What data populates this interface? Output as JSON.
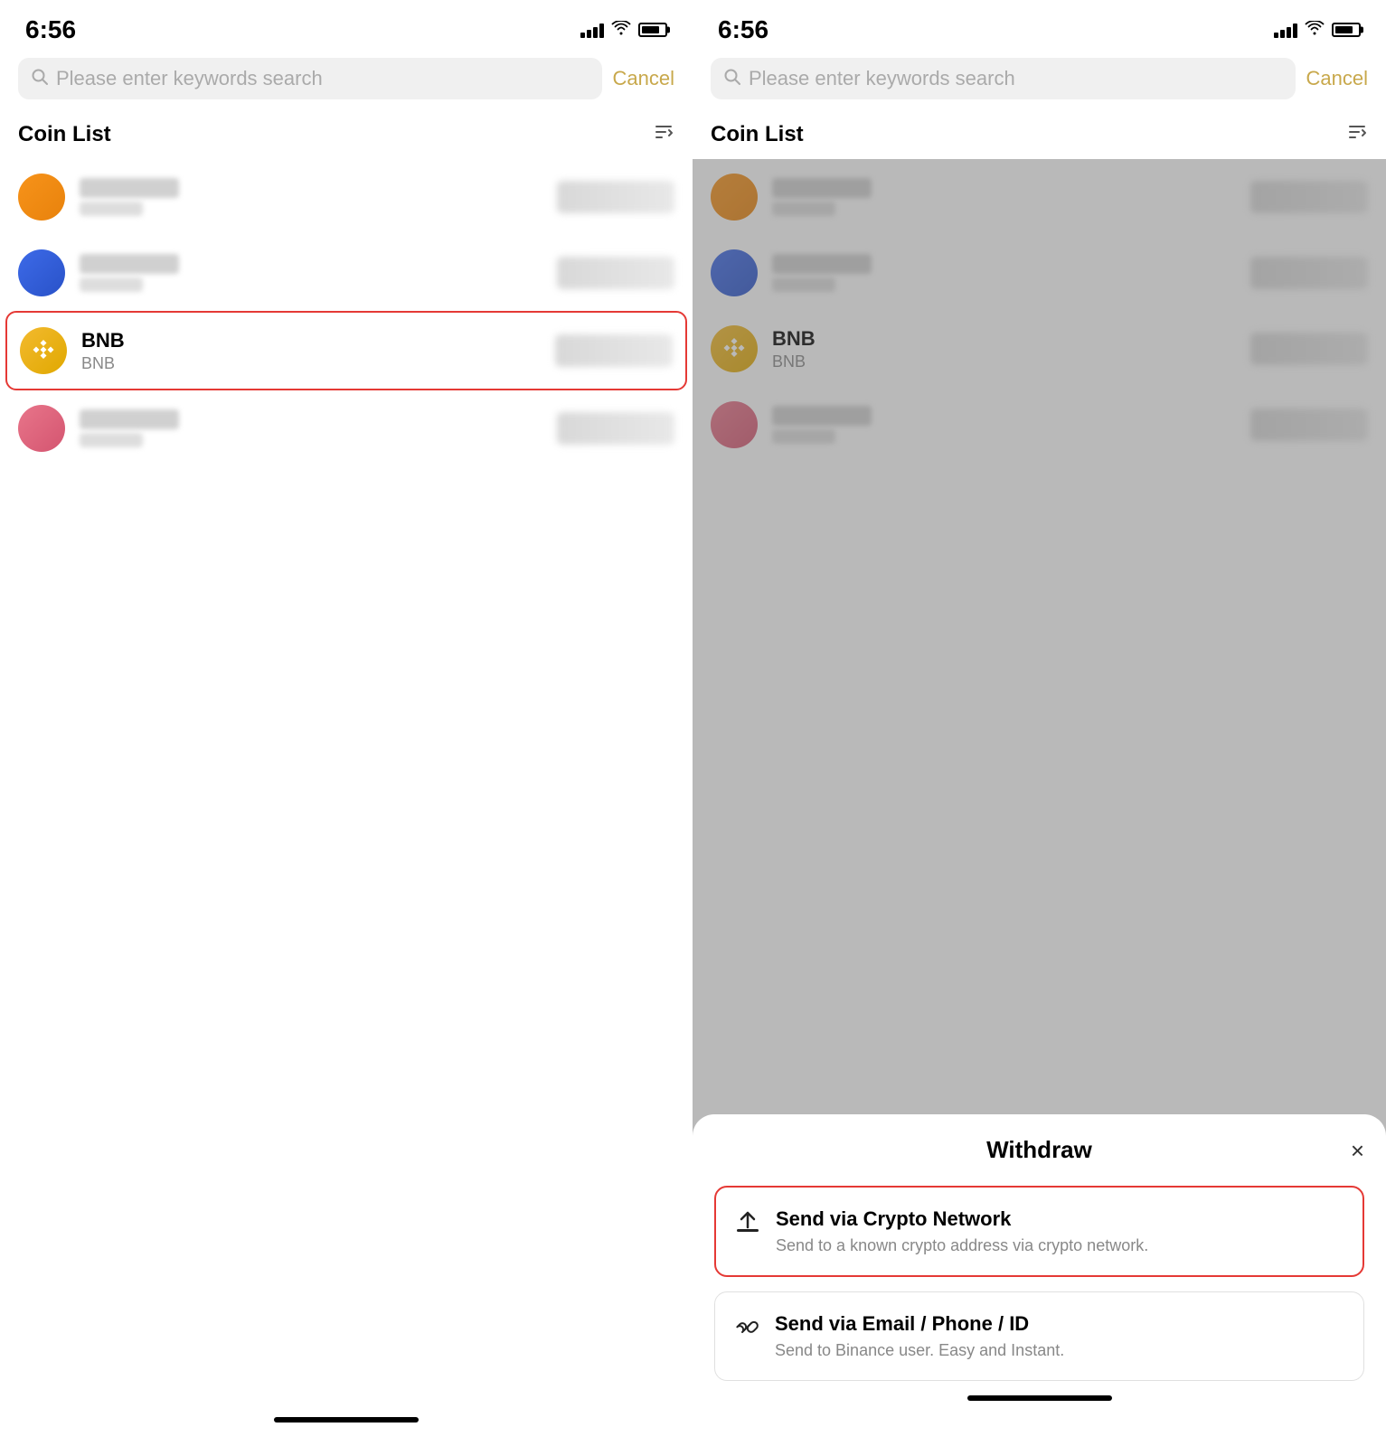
{
  "left_panel": {
    "status_time": "6:56",
    "search_placeholder": "Please enter keywords search",
    "cancel_label": "Cancel",
    "coin_list_title": "Coin List",
    "coins": [
      {
        "id": "coin1",
        "type": "orange",
        "blurred": true
      },
      {
        "id": "coin2",
        "type": "blue",
        "blurred": true
      },
      {
        "id": "bnb",
        "type": "bnb",
        "name": "BNB",
        "ticker": "BNB",
        "blurred": false,
        "highlighted": true
      },
      {
        "id": "coin4",
        "type": "pink",
        "blurred": true
      }
    ]
  },
  "right_panel": {
    "status_time": "6:56",
    "search_placeholder": "Please enter keywords search",
    "cancel_label": "Cancel",
    "coin_list_title": "Coin List",
    "coins": [
      {
        "id": "coin1r",
        "type": "orange",
        "blurred": true
      },
      {
        "id": "coin2r",
        "type": "blue",
        "blurred": true
      },
      {
        "id": "bnbr",
        "type": "bnb",
        "name": "BNB",
        "ticker": "BNB",
        "blurred": false,
        "highlighted": false
      },
      {
        "id": "coin4r",
        "type": "pink",
        "blurred": true
      }
    ],
    "bottom_sheet": {
      "title": "Withdraw",
      "close_icon": "×",
      "options": [
        {
          "id": "crypto-network",
          "icon": "⬆",
          "title": "Send via Crypto Network",
          "description": "Send to a known crypto address via crypto network.",
          "highlighted": true
        },
        {
          "id": "email-phone",
          "icon": "🔗",
          "title": "Send via Email / Phone / ID",
          "description": "Send to Binance user. Easy and Instant.",
          "highlighted": false
        }
      ]
    }
  }
}
